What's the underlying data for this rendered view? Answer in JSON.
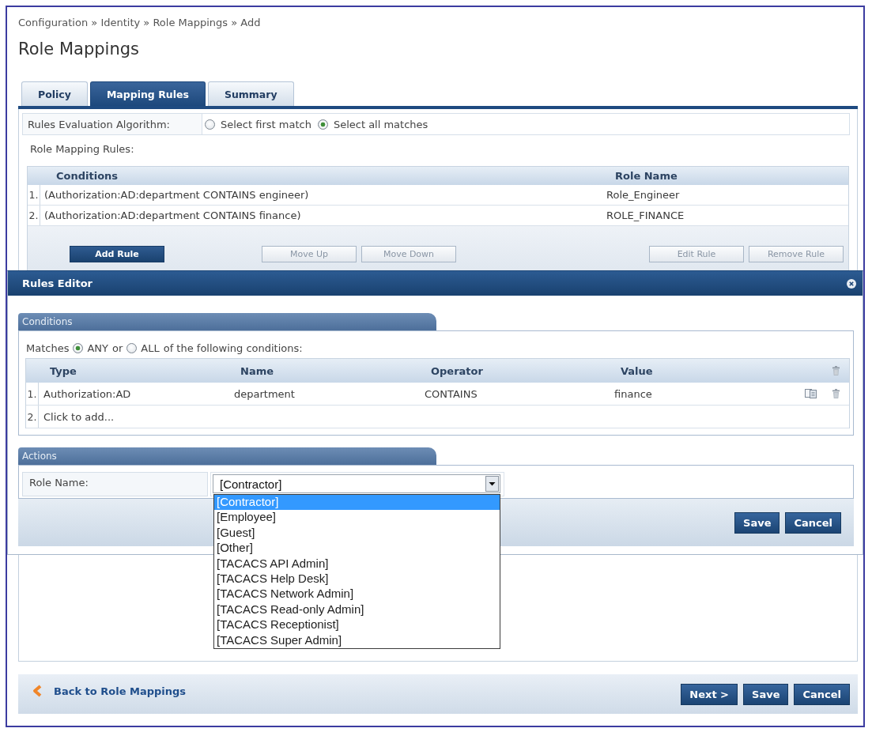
{
  "breadcrumb": "Configuration » Identity » Role Mappings » Add",
  "title": "Role Mappings",
  "tabs": [
    {
      "label": "Policy",
      "selected": false
    },
    {
      "label": "Mapping Rules",
      "selected": true
    },
    {
      "label": "Summary",
      "selected": false
    }
  ],
  "rules_evaluation": {
    "label": "Rules Evaluation Algorithm:",
    "options": [
      {
        "label": "Select first match",
        "selected": false
      },
      {
        "label": "Select all matches",
        "selected": true
      }
    ]
  },
  "role_mapping_rules": {
    "label": "Role Mapping Rules:",
    "columns": [
      "Conditions",
      "Role Name"
    ],
    "rows": [
      {
        "number": "1.",
        "conditions": "(Authorization:AD:department CONTAINS engineer)",
        "role_name": "Role_Engineer"
      },
      {
        "number": "2.",
        "conditions": "(Authorization:AD:department CONTAINS finance)",
        "role_name": "ROLE_FINANCE"
      }
    ],
    "button_groups": [
      [
        {
          "label": "Add Rule",
          "disabled": false
        }
      ],
      [
        {
          "label": "Move Up",
          "disabled": true
        },
        {
          "label": "Move Down",
          "disabled": true
        }
      ],
      [
        {
          "label": "Edit Rule",
          "disabled": true
        },
        {
          "label": "Remove Rule",
          "disabled": true
        }
      ]
    ]
  },
  "rules_editor": {
    "title": "Rules Editor",
    "conditions": {
      "title": "Conditions",
      "matches": {
        "prefix": "Matches",
        "options": [
          {
            "label": "ANY",
            "selected": true
          },
          {
            "label": "ALL",
            "selected": false
          }
        ],
        "joiner": "or",
        "suffix": "of the following conditions:"
      },
      "columns": [
        "Type",
        "Name",
        "Operator",
        "Value"
      ],
      "rows": [
        {
          "number": "1.",
          "type": "Authorization:AD",
          "name": "department",
          "operator": "CONTAINS",
          "value": "finance"
        }
      ],
      "add_row": {
        "number": "2.",
        "label": "Click to add..."
      }
    },
    "actions": {
      "title": "Actions",
      "role_name": {
        "label": "Role Name:",
        "value": "[Contractor]",
        "expanded": true,
        "options": [
          {
            "label": "[Contractor]",
            "selected": true
          },
          {
            "label": "[Employee]",
            "selected": false
          },
          {
            "label": "[Guest]",
            "selected": false
          },
          {
            "label": "[Other]",
            "selected": false
          },
          {
            "label": "[TACACS API Admin]",
            "selected": false
          },
          {
            "label": "[TACACS Help Desk]",
            "selected": false
          },
          {
            "label": "[TACACS Network Admin]",
            "selected": false
          },
          {
            "label": "[TACACS Read-only Admin]",
            "selected": false
          },
          {
            "label": "[TACACS Receptionist]",
            "selected": false
          },
          {
            "label": "[TACACS Super Admin]",
            "selected": false
          }
        ]
      }
    },
    "buttons": [
      "Save",
      "Cancel"
    ]
  },
  "footer": {
    "back_link": "Back to Role Mappings",
    "buttons": [
      "Next >",
      "Save",
      "Cancel"
    ]
  }
}
